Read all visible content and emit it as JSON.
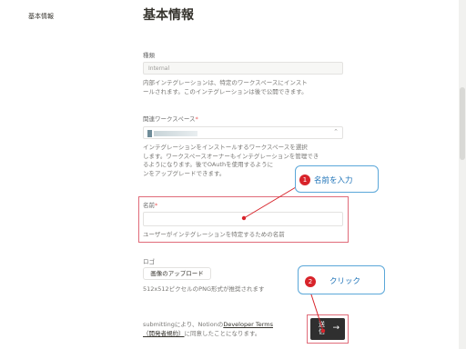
{
  "sidebar": {
    "items": [
      {
        "label": "基本情報"
      }
    ]
  },
  "page": {
    "title": "基本情報"
  },
  "type_field": {
    "label": "種類",
    "value": "Internal",
    "help_line1": "内部インテグレーションは、特定のワークスペースにインスト",
    "help_line2": "ールされます。このインテグレーションは後で公開できます。"
  },
  "workspace_field": {
    "label": "関連ワークスペース",
    "required_mark": "*",
    "help_line1": "インテグレーションをインストールするワークスペースを選択",
    "help_line2": "します。ワークスペースオーナーもインテグレーションを管理でき",
    "help_line3": "るようになります。後でOAuthを使用するように",
    "help_line4": "ンをアップグレードできます。"
  },
  "name_field": {
    "label": "名前",
    "required_mark": "*",
    "value": "",
    "help": "ユーザーがインテグレーションを特定するための名前"
  },
  "logo_field": {
    "label": "ロゴ",
    "upload_button": "画像のアップロード",
    "help": "512x512ピクセルのPNG形式が推奨されます"
  },
  "terms": {
    "prefix": "submittingにより、Notionの",
    "link1": "Developer Terms",
    "link2": "（開発者規約）",
    "suffix": "に同意したことになります。"
  },
  "submit_button": {
    "label": "送信",
    "arrow": "→"
  },
  "annotations": [
    {
      "number": "1",
      "text": "名前を入力"
    },
    {
      "number": "2",
      "text": "クリック"
    }
  ],
  "colors": {
    "highlight": "#e06b79",
    "callout_border": "#5aa7d9",
    "badge": "#d8232a"
  }
}
